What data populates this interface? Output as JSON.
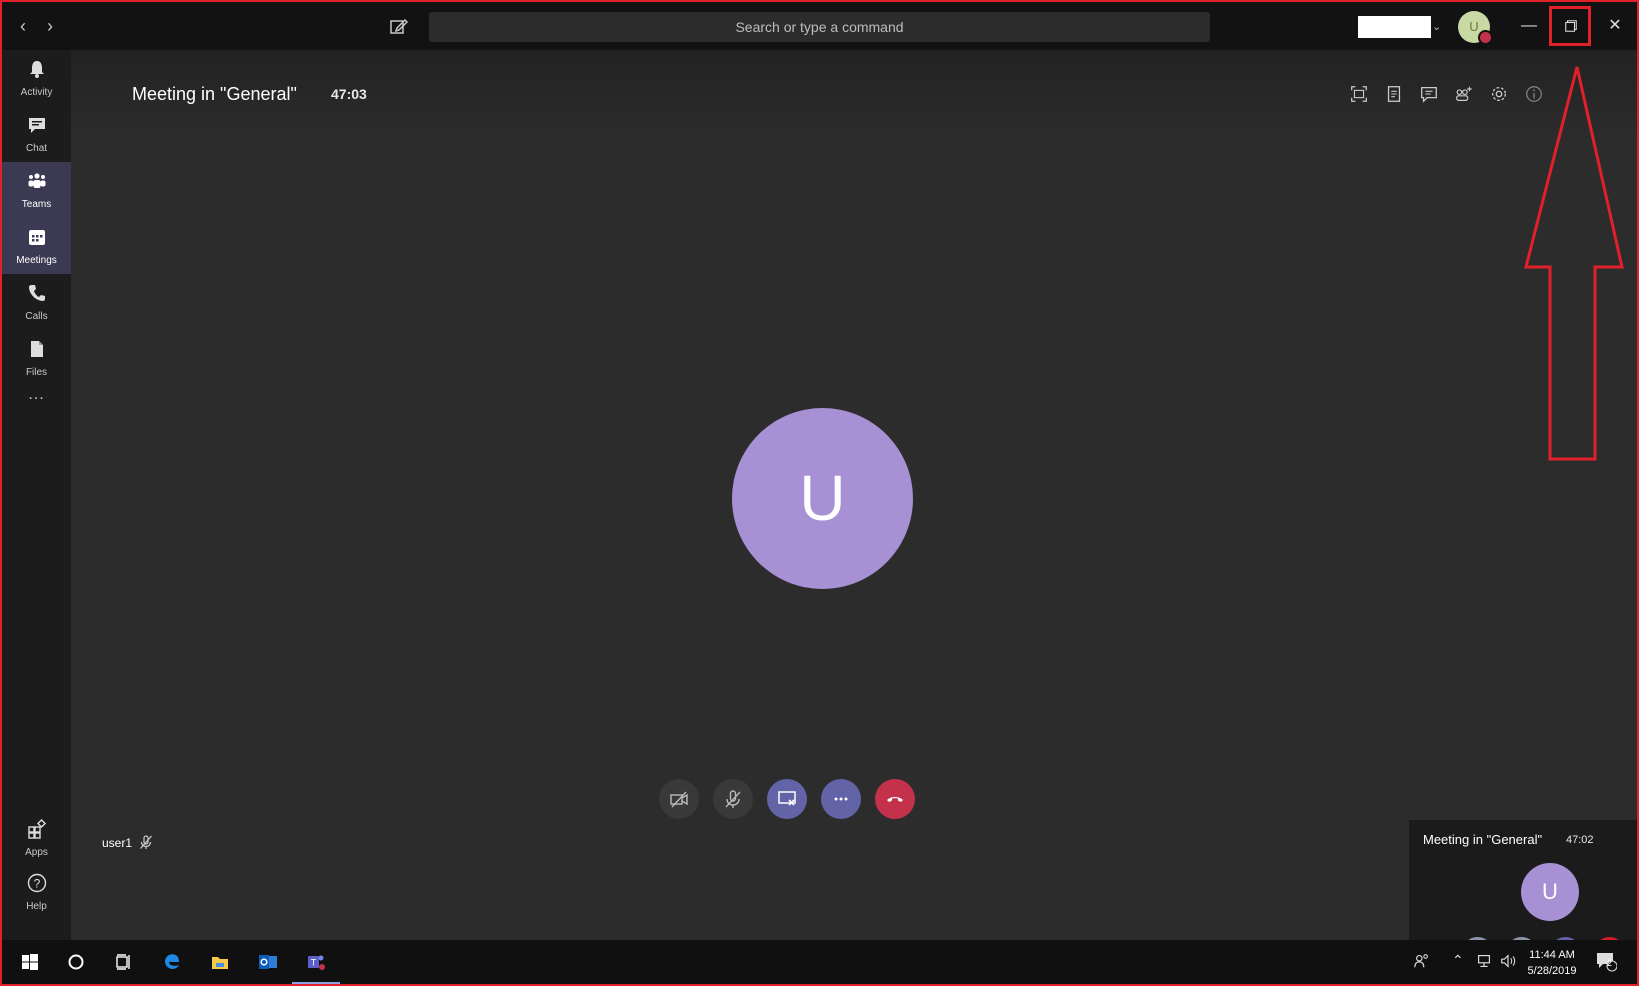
{
  "titlebar": {
    "search_placeholder": "Search or type a command",
    "avatar_initial": "U"
  },
  "rail": {
    "items": [
      {
        "label": "Activity"
      },
      {
        "label": "Chat"
      },
      {
        "label": "Teams"
      },
      {
        "label": "Meetings"
      },
      {
        "label": "Calls"
      },
      {
        "label": "Files"
      },
      {
        "label": "..."
      },
      {
        "label": "Apps"
      },
      {
        "label": "Help"
      }
    ]
  },
  "meeting": {
    "title": "Meeting in \"General\"",
    "duration": "47:03",
    "participant_initial": "U",
    "participant_name": "user1"
  },
  "mini": {
    "title": "Meeting in \"General\"",
    "duration": "47:02",
    "initial": "U",
    "minimize": "—"
  },
  "taskbar": {
    "time": "11:44 AM",
    "date": "5/28/2019",
    "notifications": "2"
  },
  "colors": {
    "accent": "#6264a7",
    "hangup": "#c4314b",
    "avatar": "#a791d4",
    "annotation": "#e0202b"
  }
}
